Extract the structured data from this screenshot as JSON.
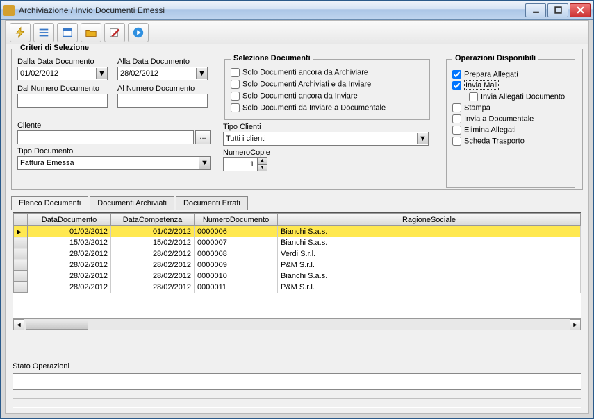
{
  "window": {
    "title": "Archiviazione / Invio Documenti Emessi"
  },
  "criteria": {
    "legend": "Criteri di Selezione",
    "dallaData": {
      "label": "Dalla Data Documento",
      "value": "01/02/2012"
    },
    "allaData": {
      "label": "Alla Data Documento",
      "value": "28/02/2012"
    },
    "dalNumero": {
      "label": "Dal Numero Documento",
      "value": ""
    },
    "alNumero": {
      "label": "Al Numero Documento",
      "value": ""
    },
    "cliente": {
      "label": "Cliente",
      "value": ""
    },
    "tipoDoc": {
      "label": "Tipo Documento",
      "value": "Fattura Emessa"
    }
  },
  "selezione": {
    "legend": "Selezione Documenti",
    "opt1": "Solo Documenti ancora da Archiviare",
    "opt2": "Solo Documenti Archiviati e da Inviare",
    "opt3": "Solo Documenti ancora da Inviare",
    "opt4": "Solo Documenti da Inviare a Documentale",
    "tipoClienti": {
      "label": "Tipo Clienti",
      "value": "Tutti i clienti"
    },
    "numeroCopie": {
      "label": "NumeroCopie",
      "value": "1"
    }
  },
  "operazioni": {
    "legend": "Operazioni Disponibili",
    "preparaAllegati": "Prepara Allegati",
    "inviaMail": "Invia Mail",
    "inviaAllegatiDoc": "Invia Allegati Documento",
    "stampa": "Stampa",
    "inviaDocumentale": "Invia a Documentale",
    "eliminaAllegati": "Elimina Allegati",
    "schedaTrasporto": "Scheda Trasporto"
  },
  "tabs": {
    "elenco": "Elenco Documenti",
    "archiviati": "Documenti Archiviati",
    "errati": "Documenti Errati"
  },
  "grid": {
    "headers": {
      "dataDoc": "DataDocumento",
      "dataComp": "DataCompetenza",
      "numDoc": "NumeroDocumento",
      "ragione": "RagioneSociale"
    },
    "rows": [
      {
        "dataDoc": "01/02/2012",
        "dataComp": "01/02/2012",
        "numDoc": "0000006",
        "ragione": "Bianchi S.a.s."
      },
      {
        "dataDoc": "15/02/2012",
        "dataComp": "15/02/2012",
        "numDoc": "0000007",
        "ragione": "Bianchi S.a.s."
      },
      {
        "dataDoc": "28/02/2012",
        "dataComp": "28/02/2012",
        "numDoc": "0000008",
        "ragione": "Verdi S.r.l."
      },
      {
        "dataDoc": "28/02/2012",
        "dataComp": "28/02/2012",
        "numDoc": "0000009",
        "ragione": "P&M S.r.l."
      },
      {
        "dataDoc": "28/02/2012",
        "dataComp": "28/02/2012",
        "numDoc": "0000010",
        "ragione": "Bianchi S.a.s."
      },
      {
        "dataDoc": "28/02/2012",
        "dataComp": "28/02/2012",
        "numDoc": "0000011",
        "ragione": "P&M S.r.l."
      }
    ]
  },
  "stato": {
    "label": "Stato Operazioni"
  }
}
